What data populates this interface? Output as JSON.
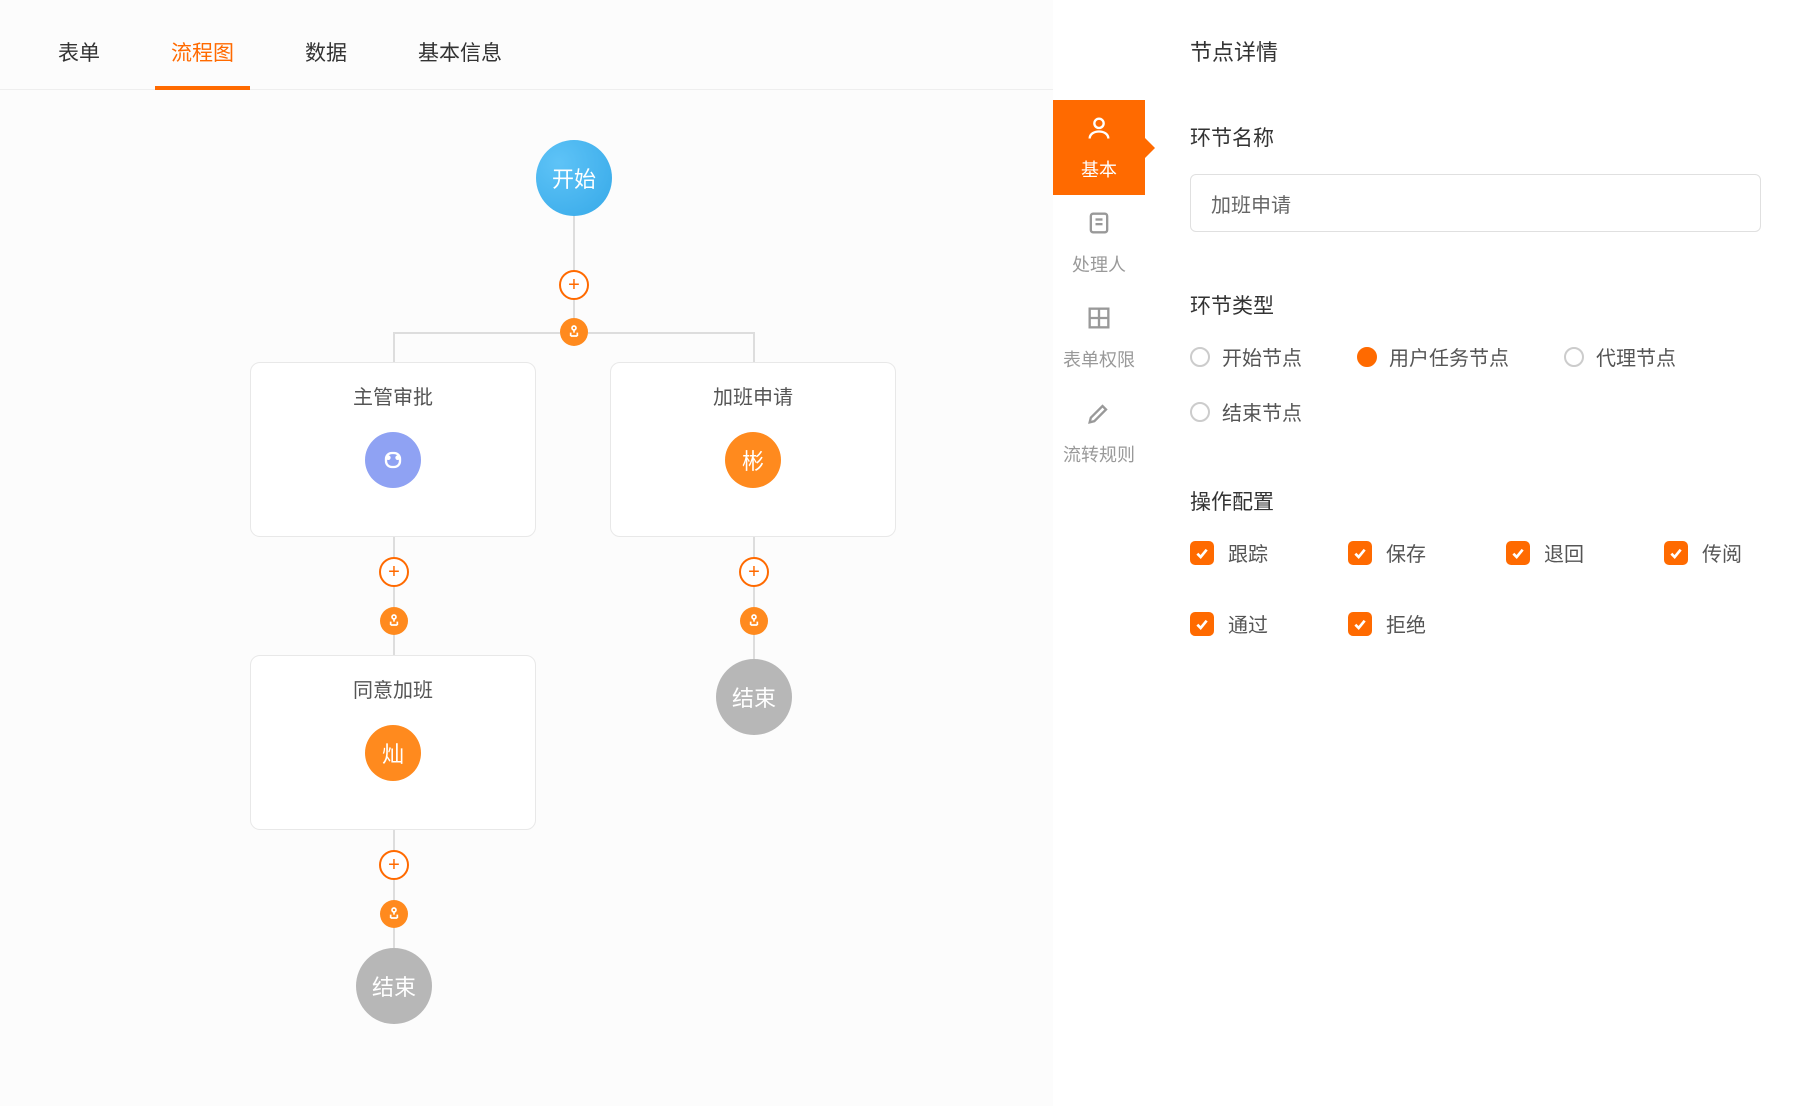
{
  "topTabs": [
    "表单",
    "流程图",
    "数据",
    "基本信息"
  ],
  "activeTopTab": 1,
  "flow": {
    "start": "开始",
    "nodes": {
      "supervisor": "主管审批",
      "overtime_request": "加班申请",
      "agree_overtime": "同意加班"
    },
    "avatars": {
      "supervisor_badge": "",
      "overtime_badge": "彬",
      "agree_badge": "灿"
    },
    "end": "结束"
  },
  "panel": {
    "title": "节点详情",
    "miniTabs": [
      "基本",
      "处理人",
      "表单权限",
      "流转规则"
    ],
    "activeMiniTab": 0,
    "nameLabel": "环节名称",
    "nameValue": "加班申请",
    "typeLabel": "环节类型",
    "typeOptions": [
      "开始节点",
      "用户任务节点",
      "代理节点",
      "结束节点"
    ],
    "typeSelected": 1,
    "opsLabel": "操作配置",
    "opsOptions": [
      "跟踪",
      "保存",
      "退回",
      "传阅",
      "通过",
      "拒绝"
    ]
  }
}
